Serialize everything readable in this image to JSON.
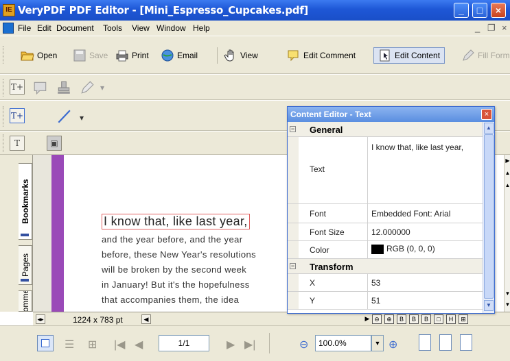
{
  "window": {
    "title": "VeryPDF PDF Editor - [Mini_Espresso_Cupcakes.pdf]",
    "app_icon_label": "IE"
  },
  "menu": {
    "items": [
      "File",
      "Edit",
      "Document",
      "Tools",
      "View",
      "Window",
      "Help"
    ]
  },
  "toolbar": {
    "open": "Open",
    "save": "Save",
    "print": "Print",
    "email": "Email",
    "view": "View",
    "edit_comment": "Edit Comment",
    "edit_content": "Edit Content",
    "fill_form": "Fill Form"
  },
  "sidebar": {
    "tabs": [
      "Bookmarks",
      "Pages",
      "Comments"
    ]
  },
  "document": {
    "heading": "I know that, like last year,",
    "lines": [
      "and the year before, and the year",
      "before, these New Year's resolutions",
      "will be broken by the second week",
      "in January! But it's the hopefulness",
      "that accompanies them, the idea"
    ]
  },
  "status": {
    "page_size": "1224 x 783 pt"
  },
  "navigation": {
    "page": "1/1",
    "zoom": "100.0%"
  },
  "content_editor": {
    "title": "Content Editor - Text",
    "general_label": "General",
    "transform_label": "Transform",
    "properties": [
      {
        "name": "Text",
        "value": "I know that, like last year,"
      },
      {
        "name": "Font",
        "value": "Embedded Font: Arial"
      },
      {
        "name": "Font Size",
        "value": "12.000000"
      },
      {
        "name": "Color",
        "value": "RGB (0, 0, 0)"
      }
    ],
    "transform": [
      {
        "name": "X",
        "value": "53"
      },
      {
        "name": "Y",
        "value": "51"
      }
    ]
  },
  "colors": {
    "title_bar": "#1e57d6",
    "chrome": "#ece9d8",
    "accent_strip": "#9a4ab8",
    "panel_title": "#5a8ee0"
  }
}
